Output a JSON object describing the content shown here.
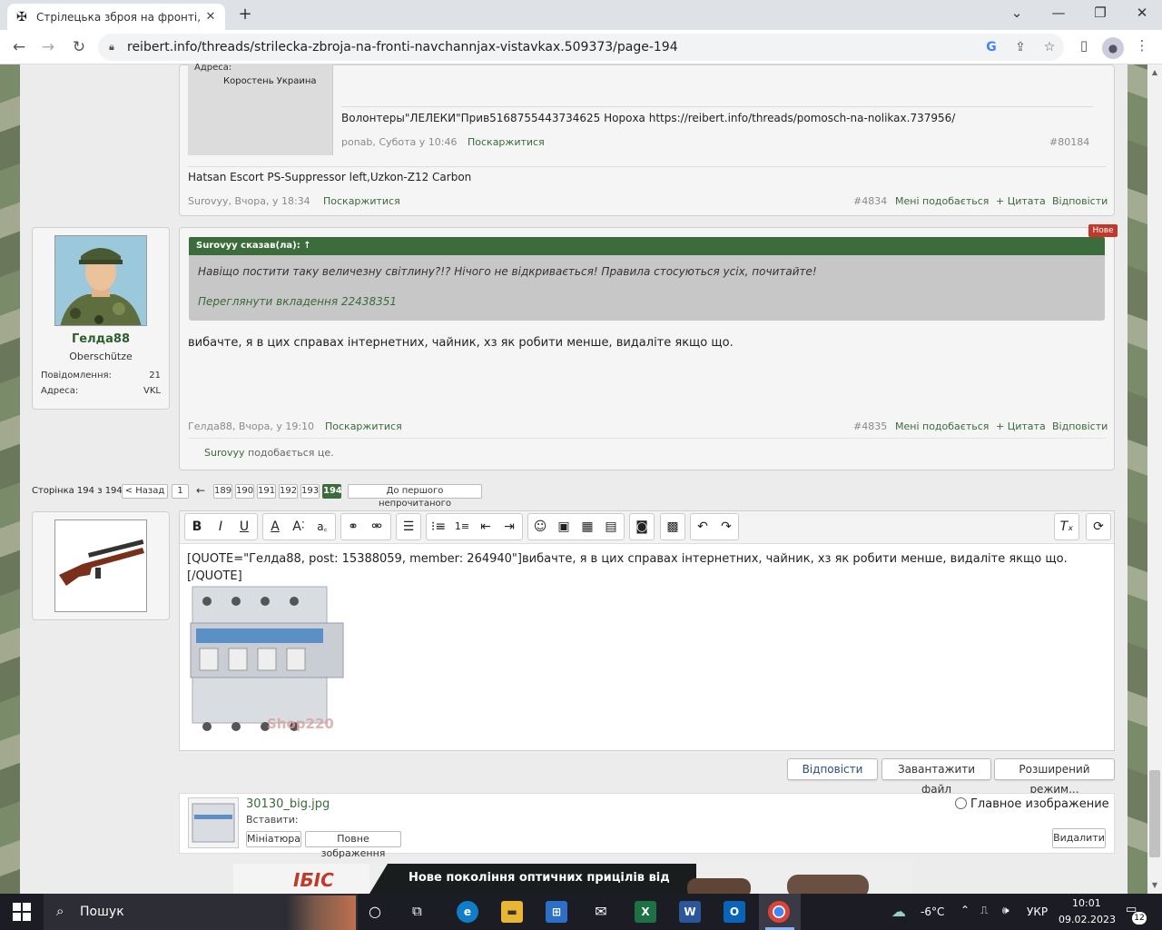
{
  "browser": {
    "tab_title": "Стрілецька зброя на фронті, на",
    "url": "reibert.info/threads/strilecka-zbroja-na-fronti-navchannjax-vistavkax.509373/page-194"
  },
  "prev_post": {
    "addr_label": "Адреса:",
    "addr_value": "Коростень Украина",
    "signature": "Волонтеры\"ЛЕЛЕКИ\"Прив5168755443734625 Нороха https://reibert.info/threads/pomosch-na-nolikax.737956/",
    "meta_author": "ponab, Субота у 10:46",
    "meta_report": "Поскаржитися",
    "meta_num": "#80184",
    "quote_text": "Hatsan Escort PS-Suppressor left,Uzkon-Z12 Carbon",
    "footer_author": "Surovyy, Вчора, у 18:34",
    "footer_report": "Поскаржитися",
    "footer_num": "#4834",
    "like": "Мені подобається",
    "cite": "+ Цитата",
    "reply": "Відповісти"
  },
  "post": {
    "user": {
      "name": "Гелда88",
      "rank": "Oberschütze",
      "messages_label": "Повідомлення:",
      "messages_value": "21",
      "addr_label": "Адреса:",
      "addr_value": "VKL"
    },
    "new_badge": "Нове",
    "quote_head": "Surovyy сказав(ла): ↑",
    "quote_text": "Навіщо постити таку величезну світлину?!? Нічого не відкривається! Правила стосуються усіх, почитайте!",
    "quote_link": "Переглянути вкладення 22438351",
    "body": "вибачте, я в цих справах інтернетних, чайник, хз як робити менше, видаліте якщо що.",
    "meta_author": "Гелда88, Вчора, у 19:10",
    "meta_report": "Поскаржитися",
    "meta_num": "#4835",
    "like": "Мені подобається",
    "cite": "+ Цитата",
    "reply": "Відповісти",
    "likes_user": "Surovyy",
    "likes_text": " подобається це."
  },
  "pagination": {
    "label": "Сторінка 194 з 194",
    "prev": "< Назад",
    "first": "1",
    "ellipsis": "←",
    "pages": [
      "189",
      "190",
      "191",
      "192",
      "193"
    ],
    "current": "194",
    "unread": "До першого непрочитаного"
  },
  "editor": {
    "line1": "[QUOTE=\"Гелда88, post: 15388059, member: 264940\"]вибачте, я в цих справах інтернетних, чайник, хз як робити менше, видаліте  якщо що.",
    "line2": "[/QUOTE]",
    "image_watermark": "Shop220",
    "reply_button": "Відповісти",
    "upload_button": "Завантажити файл",
    "advanced_button": "Розширений режим..."
  },
  "attachment": {
    "filename": "30130_big.jpg",
    "insert_label": "Вставити:",
    "thumb_button": "Мініатюра",
    "full_button": "Повне зображення",
    "main_image_label": "Главное изображение",
    "delete_button": "Видалити"
  },
  "banner": {
    "brand": "ІБІС",
    "text": "Нове покоління оптичних прицілів від"
  },
  "taskbar": {
    "search": "Пошук",
    "weather": "-6°C",
    "lang": "УКР",
    "time": "10:01",
    "date": "09.02.2023",
    "notif": "12"
  },
  "colors": {
    "accent_green": "#3c6b3c",
    "badge_red": "#c0392b"
  }
}
